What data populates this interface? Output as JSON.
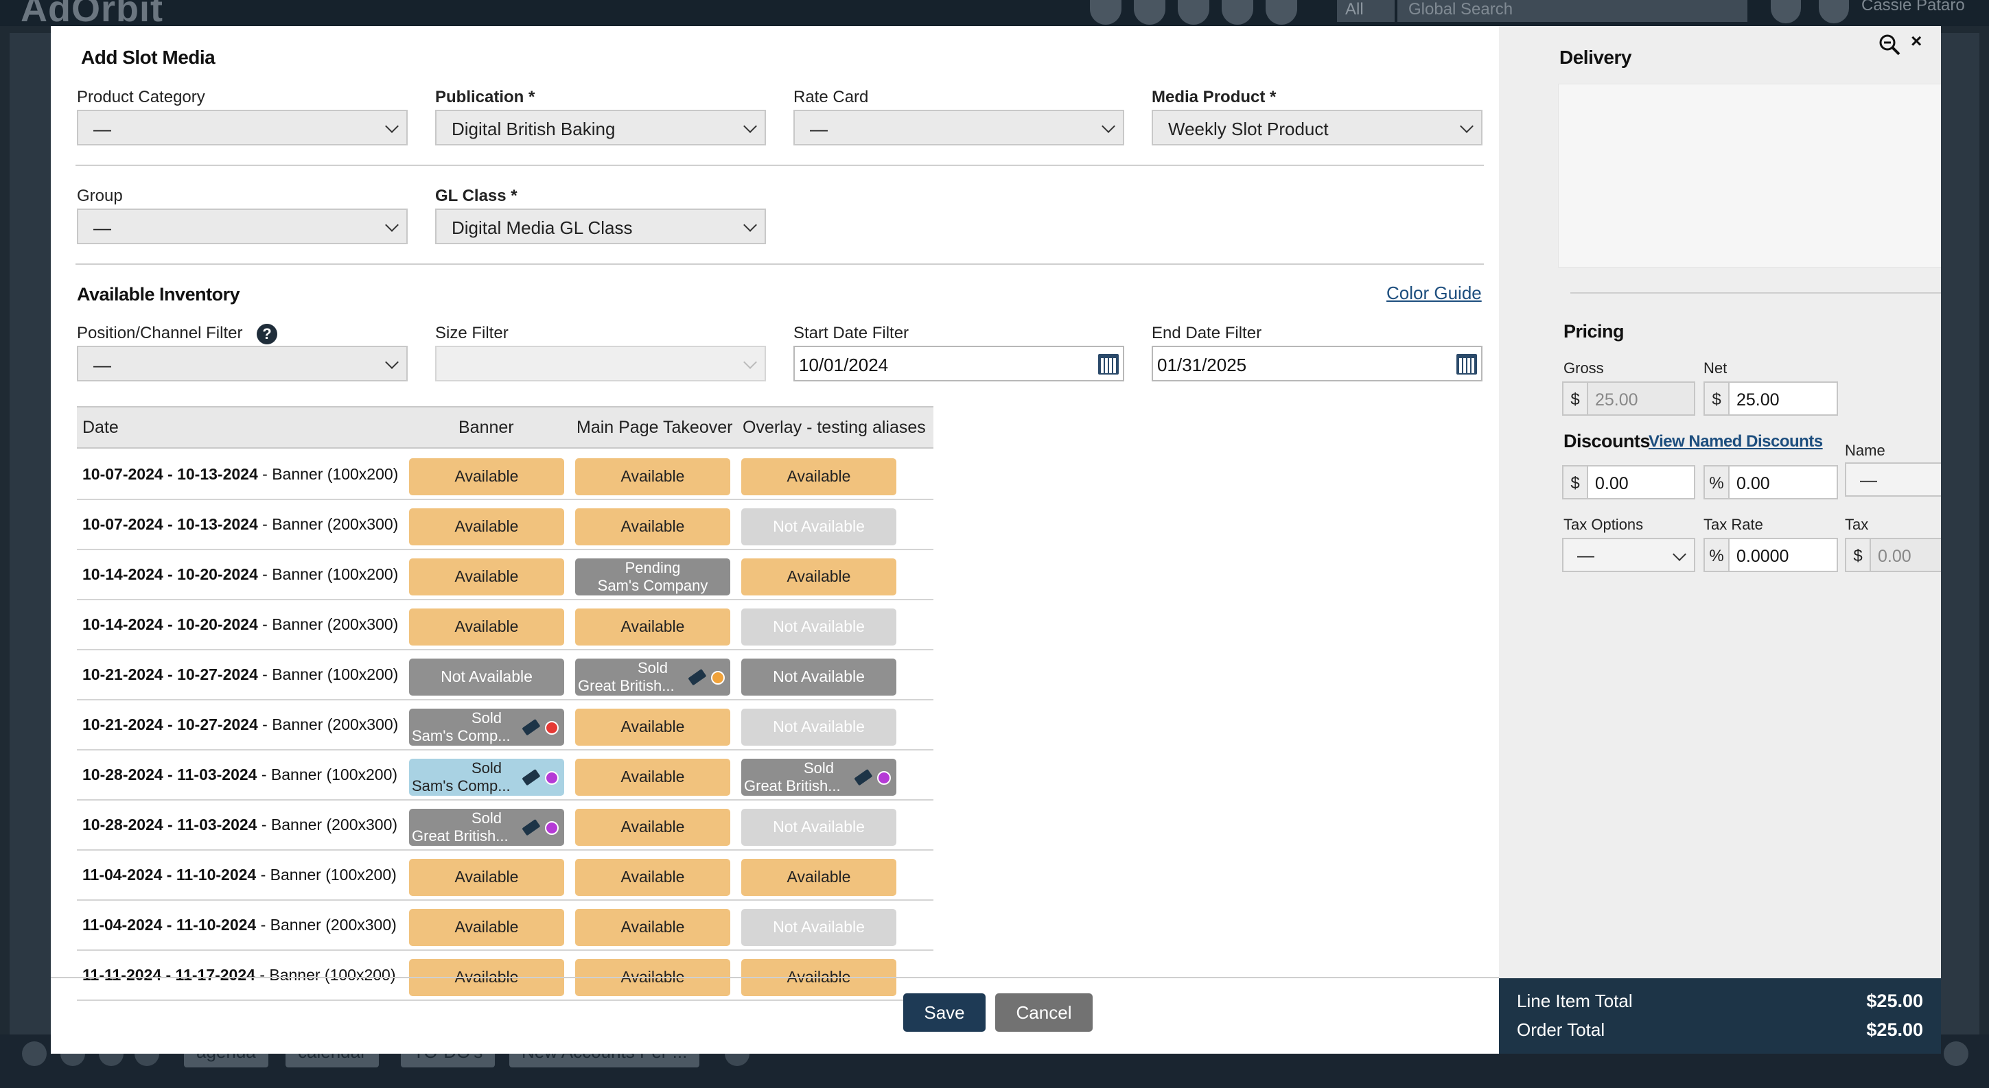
{
  "app": {
    "logo": "AdOrbit",
    "search_scope": "All",
    "search_placeholder": "Global Search",
    "user_name": "Cassie Pataro",
    "bottom_tabs": [
      "agenda",
      "calendar",
      "TO-DO's",
      "New Accounts Per ..."
    ]
  },
  "modal": {
    "title": "Add Slot Media",
    "fields": {
      "product_category": {
        "label": "Product Category",
        "value": "—"
      },
      "publication": {
        "label": "Publication *",
        "value": "Digital British Baking"
      },
      "rate_card": {
        "label": "Rate Card",
        "value": "—"
      },
      "media_product": {
        "label": "Media Product *",
        "value": "Weekly Slot Product"
      },
      "group": {
        "label": "Group",
        "value": "—"
      },
      "gl_class": {
        "label": "GL Class *",
        "value": "Digital Media GL Class"
      }
    },
    "inventory": {
      "title": "Available Inventory",
      "color_guide": "Color Guide",
      "position_filter": {
        "label": "Position/Channel Filter",
        "value": "—"
      },
      "size_filter": {
        "label": "Size Filter",
        "value": ""
      },
      "start_date": {
        "label": "Start Date Filter",
        "value": "10/01/2024"
      },
      "end_date": {
        "label": "End Date Filter",
        "value": "01/31/2025"
      }
    },
    "table": {
      "headers": [
        "Date",
        "Banner",
        "Main Page Takeover",
        "Overlay - testing aliases"
      ],
      "rows": [
        {
          "dates": "10-07-2024 - 10-13-2024",
          "size": " - Banner (100x200)",
          "cells": [
            {
              "type": "avail",
              "l1": "Available"
            },
            {
              "type": "avail",
              "l1": "Available"
            },
            {
              "type": "avail",
              "l1": "Available"
            }
          ]
        },
        {
          "dates": "10-07-2024 - 10-13-2024",
          "size": " - Banner (200x300)",
          "cells": [
            {
              "type": "avail",
              "l1": "Available"
            },
            {
              "type": "avail",
              "l1": "Available"
            },
            {
              "type": "na",
              "l1": "Not Available"
            }
          ]
        },
        {
          "dates": "10-14-2024 - 10-20-2024",
          "size": " - Banner (100x200)",
          "cells": [
            {
              "type": "avail",
              "l1": "Available"
            },
            {
              "type": "pending",
              "l1": "Pending",
              "l2": "Sam's Company"
            },
            {
              "type": "avail",
              "l1": "Available"
            }
          ]
        },
        {
          "dates": "10-14-2024 - 10-20-2024",
          "size": " - Banner (200x300)",
          "cells": [
            {
              "type": "avail",
              "l1": "Available"
            },
            {
              "type": "avail",
              "l1": "Available"
            },
            {
              "type": "na",
              "l1": "Not Available"
            }
          ]
        },
        {
          "dates": "10-21-2024 - 10-27-2024",
          "size": " - Banner (100x200)",
          "cells": [
            {
              "type": "nadark",
              "l1": "Not Available"
            },
            {
              "type": "sold",
              "l1": "Sold",
              "l2": "Great British...",
              "dot": "#f0a23a"
            },
            {
              "type": "nadark",
              "l1": "Not Available"
            }
          ]
        },
        {
          "dates": "10-21-2024 - 10-27-2024",
          "size": " - Banner (200x300)",
          "cells": [
            {
              "type": "sold",
              "l1": "Sold",
              "l2": "Sam's Comp...",
              "dot": "#e53935"
            },
            {
              "type": "avail",
              "l1": "Available"
            },
            {
              "type": "na",
              "l1": "Not Available"
            }
          ]
        },
        {
          "dates": "10-28-2024 - 11-03-2024",
          "size": " - Banner (100x200)",
          "cells": [
            {
              "type": "soldblue",
              "l1": "Sold",
              "l2": "Sam's Comp...",
              "dot": "#b53ad6"
            },
            {
              "type": "avail",
              "l1": "Available"
            },
            {
              "type": "sold",
              "l1": "Sold",
              "l2": "Great British...",
              "dot": "#b53ad6"
            }
          ]
        },
        {
          "dates": "10-28-2024 - 11-03-2024",
          "size": " - Banner (200x300)",
          "cells": [
            {
              "type": "sold",
              "l1": "Sold",
              "l2": "Great British...",
              "dot": "#b53ad6"
            },
            {
              "type": "avail",
              "l1": "Available"
            },
            {
              "type": "na",
              "l1": "Not Available"
            }
          ]
        },
        {
          "dates": "11-04-2024 - 11-10-2024",
          "size": " - Banner (100x200)",
          "cells": [
            {
              "type": "avail",
              "l1": "Available"
            },
            {
              "type": "avail",
              "l1": "Available"
            },
            {
              "type": "avail",
              "l1": "Available"
            }
          ]
        },
        {
          "dates": "11-04-2024 - 11-10-2024",
          "size": " - Banner (200x300)",
          "cells": [
            {
              "type": "avail",
              "l1": "Available"
            },
            {
              "type": "avail",
              "l1": "Available"
            },
            {
              "type": "na",
              "l1": "Not Available"
            }
          ]
        },
        {
          "dates": "11-11-2024 - 11-17-2024",
          "size": " - Banner (100x200)",
          "cells": [
            {
              "type": "avail",
              "l1": "Available"
            },
            {
              "type": "avail",
              "l1": "Available"
            },
            {
              "type": "avail",
              "l1": "Available"
            }
          ]
        }
      ]
    },
    "buttons": {
      "save": "Save",
      "cancel": "Cancel"
    }
  },
  "side": {
    "delivery_title": "Delivery",
    "close_symbol": "×",
    "pricing": {
      "title": "Pricing",
      "gross": {
        "label": "Gross",
        "prefix": "$",
        "value": "25.00"
      },
      "net": {
        "label": "Net",
        "prefix": "$",
        "value": "25.00"
      }
    },
    "discounts": {
      "title": "Discounts",
      "link": "View Named Discounts",
      "name_label": "Name Discount",
      "amount": {
        "prefix": "$",
        "value": "0.00"
      },
      "percent": {
        "prefix": "%",
        "value": "0.00"
      },
      "name_value": "—"
    },
    "tax": {
      "options_label": "Tax Options",
      "options_value": "—",
      "rate_label": "Tax Rate",
      "rate": {
        "prefix": "%",
        "value": "0.0000"
      },
      "tax_label": "Tax",
      "tax": {
        "prefix": "$",
        "value": "0.00"
      }
    },
    "totals": {
      "line_item_label": "Line Item Total",
      "line_item_value": "$25.00",
      "order_label": "Order Total",
      "order_value": "$25.00"
    }
  }
}
